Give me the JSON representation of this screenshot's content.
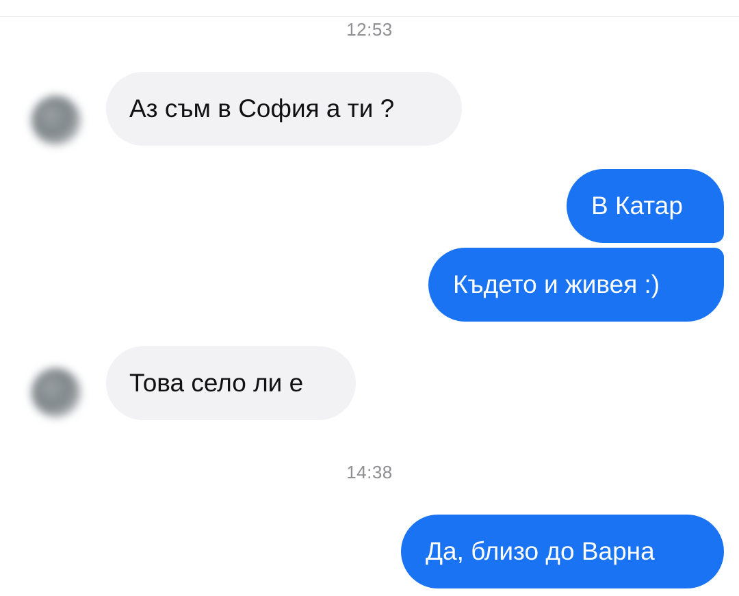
{
  "conversation": {
    "timestamps": [
      "12:53",
      "14:38"
    ],
    "messages": [
      {
        "sender": "incoming",
        "text": "Аз съм в София а ти ?"
      },
      {
        "sender": "outgoing",
        "text": "В Катар"
      },
      {
        "sender": "outgoing",
        "text": "Където и живея :)"
      },
      {
        "sender": "incoming",
        "text": "Това село ли е"
      },
      {
        "sender": "outgoing",
        "text": "Да, близо до Варна"
      }
    ]
  },
  "colors": {
    "outgoing_bubble": "#1a73f2",
    "incoming_bubble": "#f2f2f5",
    "timestamp_text": "#8e8e93"
  }
}
